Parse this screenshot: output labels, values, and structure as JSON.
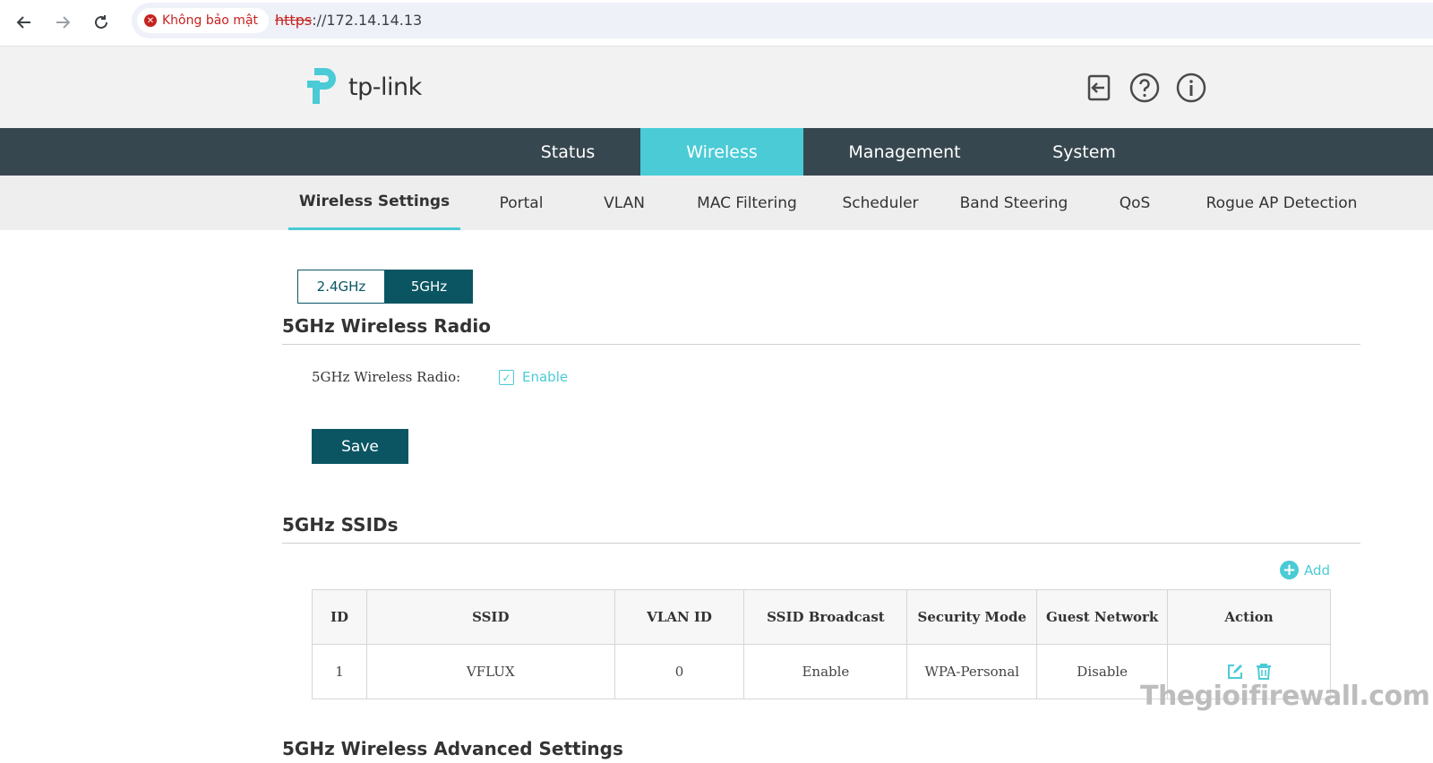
{
  "browser": {
    "security_label": "Không bảo mật",
    "url_scheme": "https",
    "url_rest": "://172.14.14.13"
  },
  "header": {
    "logo_text": "tp-link"
  },
  "main_nav": [
    {
      "label": "Status"
    },
    {
      "label": "Wireless",
      "active": true
    },
    {
      "label": "Management"
    },
    {
      "label": "System"
    }
  ],
  "sub_nav": [
    {
      "label": "Wireless Settings",
      "active": true
    },
    {
      "label": "Portal"
    },
    {
      "label": "VLAN"
    },
    {
      "label": "MAC Filtering"
    },
    {
      "label": "Scheduler"
    },
    {
      "label": "Band Steering"
    },
    {
      "label": "QoS"
    },
    {
      "label": "Rogue AP Detection"
    }
  ],
  "band_toggle": {
    "option_24": "2.4GHz",
    "option_5": "5GHz",
    "selected": "5GHz"
  },
  "radio_section": {
    "title": "5GHz Wireless Radio",
    "field_label": "5GHz Wireless Radio:",
    "checkbox_label": "Enable",
    "checked": true,
    "save_label": "Save"
  },
  "ssid_section": {
    "title": "5GHz SSIDs",
    "add_label": "Add",
    "columns": [
      "ID",
      "SSID",
      "VLAN ID",
      "SSID Broadcast",
      "Security Mode",
      "Guest Network",
      "Action"
    ],
    "rows": [
      {
        "id": "1",
        "ssid": "VFLUX",
        "vlan_id": "0",
        "broadcast": "Enable",
        "security": "WPA-Personal",
        "guest": "Disable"
      }
    ]
  },
  "next_section_title": "5GHz Wireless Advanced Settings",
  "watermark": "Thegioifirewall.com",
  "colors": {
    "accent": "#4acbd6",
    "nav_bg": "#37474f",
    "primary_button": "#0b5563"
  }
}
